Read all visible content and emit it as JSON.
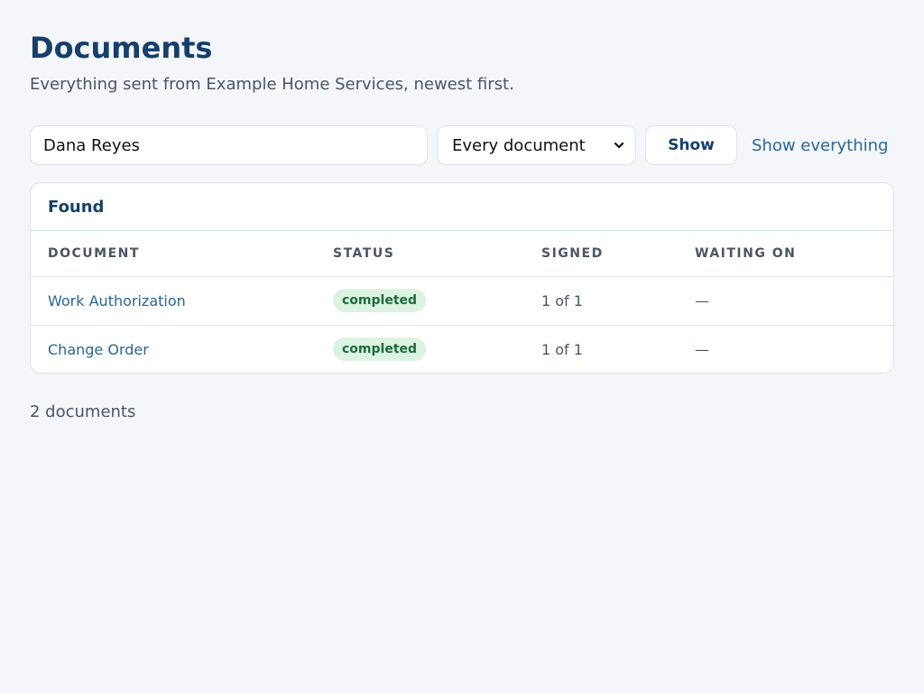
{
  "header": {
    "title": "Documents",
    "subtitle": "Everything sent from Example Home Services, newest first."
  },
  "filters": {
    "search_value": "Dana Reyes",
    "document_type_selected": "Every document",
    "show_label": "Show",
    "show_all_label": "Show everything"
  },
  "results": {
    "title": "Found",
    "columns": [
      "DOCUMENT",
      "STATUS",
      "SIGNED",
      "WAITING ON"
    ],
    "rows": [
      {
        "document": "Work Authorization",
        "status": "completed",
        "signed": "1 of 1",
        "waiting_on": "—"
      },
      {
        "document": "Change Order",
        "status": "completed",
        "signed": "1 of 1",
        "waiting_on": "—"
      }
    ],
    "count_text": "2 documents"
  },
  "colors": {
    "accent": "#163f6b",
    "link": "#2a6596",
    "status_completed_bg": "#dcf3e4",
    "status_completed_text": "#1d6b3b"
  }
}
